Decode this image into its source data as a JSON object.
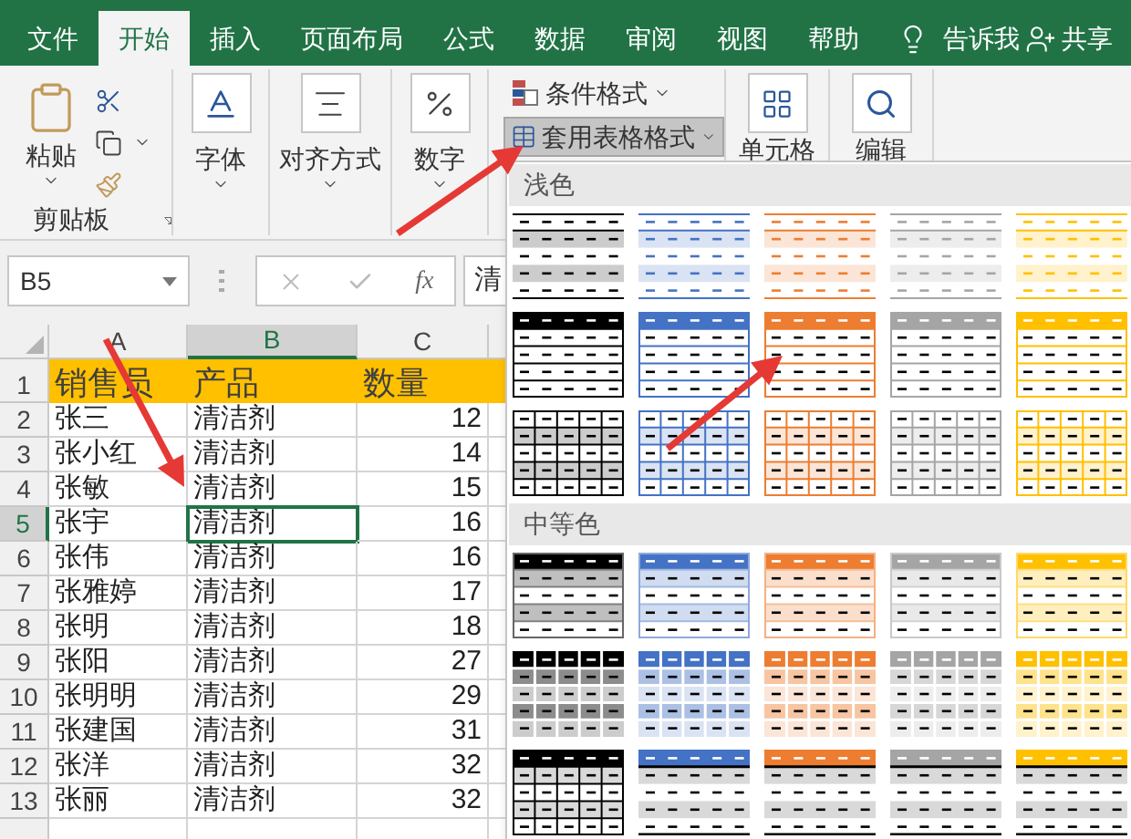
{
  "tabs": [
    {
      "label": "文件",
      "selected": false
    },
    {
      "label": "开始",
      "selected": true
    },
    {
      "label": "插入",
      "selected": false
    },
    {
      "label": "页面布局",
      "selected": false
    },
    {
      "label": "公式",
      "selected": false
    },
    {
      "label": "数据",
      "selected": false
    },
    {
      "label": "审阅",
      "selected": false
    },
    {
      "label": "视图",
      "selected": false
    },
    {
      "label": "帮助",
      "selected": false
    }
  ],
  "tell_me": "告诉我",
  "share": "共享",
  "ribbon": {
    "paste": "粘贴",
    "clipboard_label": "剪贴板",
    "groups": [
      {
        "label": "字体",
        "kind": "font"
      },
      {
        "label": "对齐方式",
        "kind": "align"
      },
      {
        "label": "数字",
        "kind": "number"
      }
    ],
    "styles": [
      {
        "label": "条件格式",
        "kind": "conditional",
        "pressed": false
      },
      {
        "label": "套用表格格式",
        "kind": "table",
        "pressed": true
      }
    ],
    "tail_groups": [
      {
        "label": "单元格",
        "kind": "cells"
      },
      {
        "label": "编辑",
        "kind": "edit"
      }
    ]
  },
  "formula_bar": {
    "name_box": "B5",
    "fx": "fx",
    "value": "清"
  },
  "sheet": {
    "columns": [
      {
        "label": "A",
        "kind": "text",
        "selected": false
      },
      {
        "label": "B",
        "kind": "text",
        "selected": true
      },
      {
        "label": "C",
        "kind": "number",
        "selected": false
      }
    ],
    "rows": [
      {
        "number": "1",
        "kind": "header",
        "selected": false,
        "cells": [
          "销售员",
          "产品",
          "数量"
        ]
      },
      {
        "number": "2",
        "kind": "data",
        "selected": false,
        "cells": [
          "张三",
          "清洁剂",
          "12"
        ]
      },
      {
        "number": "3",
        "kind": "data",
        "selected": false,
        "cells": [
          "张小红",
          "清洁剂",
          "14"
        ]
      },
      {
        "number": "4",
        "kind": "data",
        "selected": false,
        "cells": [
          "张敏",
          "清洁剂",
          "15"
        ]
      },
      {
        "number": "5",
        "kind": "data",
        "selected": true,
        "cells": [
          "张宇",
          "清洁剂",
          "16"
        ]
      },
      {
        "number": "6",
        "kind": "data",
        "selected": false,
        "cells": [
          "张伟",
          "清洁剂",
          "16"
        ]
      },
      {
        "number": "7",
        "kind": "data",
        "selected": false,
        "cells": [
          "张雅婷",
          "清洁剂",
          "17"
        ]
      },
      {
        "number": "8",
        "kind": "data",
        "selected": false,
        "cells": [
          "张明",
          "清洁剂",
          "18"
        ]
      },
      {
        "number": "9",
        "kind": "data",
        "selected": false,
        "cells": [
          "张阳",
          "清洁剂",
          "27"
        ]
      },
      {
        "number": "10",
        "kind": "data",
        "selected": false,
        "cells": [
          "张明明",
          "清洁剂",
          "29"
        ]
      },
      {
        "number": "11",
        "kind": "data",
        "selected": false,
        "cells": [
          "张建国",
          "清洁剂",
          "31"
        ]
      },
      {
        "number": "12",
        "kind": "data",
        "selected": false,
        "cells": [
          "张洋",
          "清洁剂",
          "32"
        ]
      },
      {
        "number": "13",
        "kind": "data",
        "selected": false,
        "cells": [
          "张丽",
          "清洁剂",
          "32"
        ]
      }
    ]
  },
  "gallery": {
    "sections": [
      {
        "title": "浅色",
        "styles": [
          {
            "kind": "lines-banded",
            "color": "#000000"
          },
          {
            "kind": "lines-banded",
            "color": "#4472c4"
          },
          {
            "kind": "lines-banded",
            "color": "#ed7d31"
          },
          {
            "kind": "lines-banded",
            "color": "#a5a5a5"
          },
          {
            "kind": "lines-banded",
            "color": "#ffc000"
          },
          {
            "kind": "header-rows",
            "color": "#000000"
          },
          {
            "kind": "header-rows",
            "color": "#4472c4"
          },
          {
            "kind": "header-rows",
            "color": "#ed7d31"
          },
          {
            "kind": "header-rows",
            "color": "#a5a5a5"
          },
          {
            "kind": "header-rows",
            "color": "#ffc000"
          },
          {
            "kind": "grid-banded",
            "color": "#000000"
          },
          {
            "kind": "grid-banded",
            "color": "#4472c4"
          },
          {
            "kind": "grid-banded",
            "color": "#ed7d31"
          },
          {
            "kind": "grid-banded",
            "color": "#a5a5a5"
          },
          {
            "kind": "grid-banded",
            "color": "#ffc000"
          }
        ]
      },
      {
        "title": "中等色",
        "styles": [
          {
            "kind": "header-banded",
            "color": "#000000"
          },
          {
            "kind": "header-banded",
            "color": "#4472c4"
          },
          {
            "kind": "header-banded",
            "color": "#ed7d31"
          },
          {
            "kind": "header-banded",
            "color": "#a5a5a5"
          },
          {
            "kind": "header-banded",
            "color": "#ffc000"
          },
          {
            "kind": "header-grid-shaded",
            "color": "#000000"
          },
          {
            "kind": "header-grid-shaded",
            "color": "#4472c4"
          },
          {
            "kind": "header-grid-shaded",
            "color": "#ed7d31"
          },
          {
            "kind": "header-grid-shaded",
            "color": "#a5a5a5"
          },
          {
            "kind": "header-grid-shaded",
            "color": "#ffc000"
          },
          {
            "kind": "header-grid-banded",
            "color": "#000000"
          },
          {
            "kind": "header-gray-bands",
            "color": "#4472c4"
          },
          {
            "kind": "header-gray-bands",
            "color": "#ed7d31"
          },
          {
            "kind": "header-gray-bands",
            "color": "#a5a5a5"
          },
          {
            "kind": "header-gray-bands",
            "color": "#ffc000"
          }
        ]
      }
    ]
  }
}
